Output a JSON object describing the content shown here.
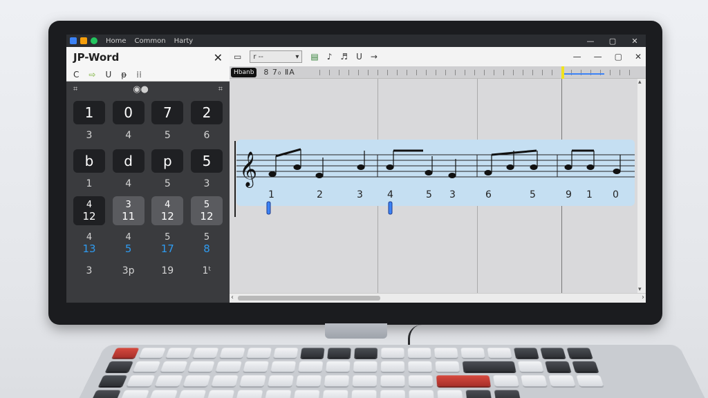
{
  "app": {
    "menu": [
      "Home",
      "Common",
      "Harty"
    ],
    "window_controls": [
      "—",
      "▢",
      "✕"
    ]
  },
  "left_panel": {
    "title": "JP-Word",
    "close": "✕",
    "tools": [
      "C",
      "⇨",
      "U",
      "ᵽ",
      "⁞⁞"
    ],
    "sub_left": "⌗",
    "sub_mid": "◉●",
    "sub_right": "⌗",
    "rows": [
      {
        "buttons": [
          "1",
          "0",
          "7",
          "2"
        ],
        "labels": [
          "3",
          "4",
          "5",
          "6"
        ]
      },
      {
        "buttons": [
          "b",
          "d",
          "p",
          "5"
        ],
        "labels": [
          "1",
          "4",
          "5",
          "3"
        ]
      }
    ],
    "fraction_row": [
      {
        "top": "4",
        "bottom": "12"
      },
      {
        "top": "3",
        "bottom": "11"
      },
      {
        "top": "4",
        "bottom": "12"
      },
      {
        "top": "5",
        "bottom": "12"
      }
    ],
    "fraction_row_blue": [
      {
        "top": "4",
        "bottom": "13"
      },
      {
        "top": "4",
        "bottom": "5"
      },
      {
        "top": "5",
        "bottom": "17"
      },
      {
        "top": "5",
        "bottom": "8"
      }
    ],
    "bottom_labels": [
      "3",
      "3p",
      "19",
      "1ᵗ"
    ]
  },
  "toolbar": {
    "dropdown_value": "r --",
    "icons": [
      "▭",
      "▤",
      "♪",
      "♬",
      "ᑌ",
      "→"
    ],
    "right_ctrls": [
      "—",
      "—",
      "▢",
      "✕"
    ]
  },
  "ruler": {
    "tag": "Hbanb",
    "nums": "8  7₀  ⅡA"
  },
  "staff": {
    "numbers": [
      "1",
      "2",
      "3",
      "4",
      "5",
      "3",
      "6",
      "5",
      "9",
      "1",
      "0"
    ]
  },
  "colors": {
    "accent": "#2f9bf0",
    "playhead": "#f0e31d",
    "staff_highlight": "#c5dff2"
  }
}
